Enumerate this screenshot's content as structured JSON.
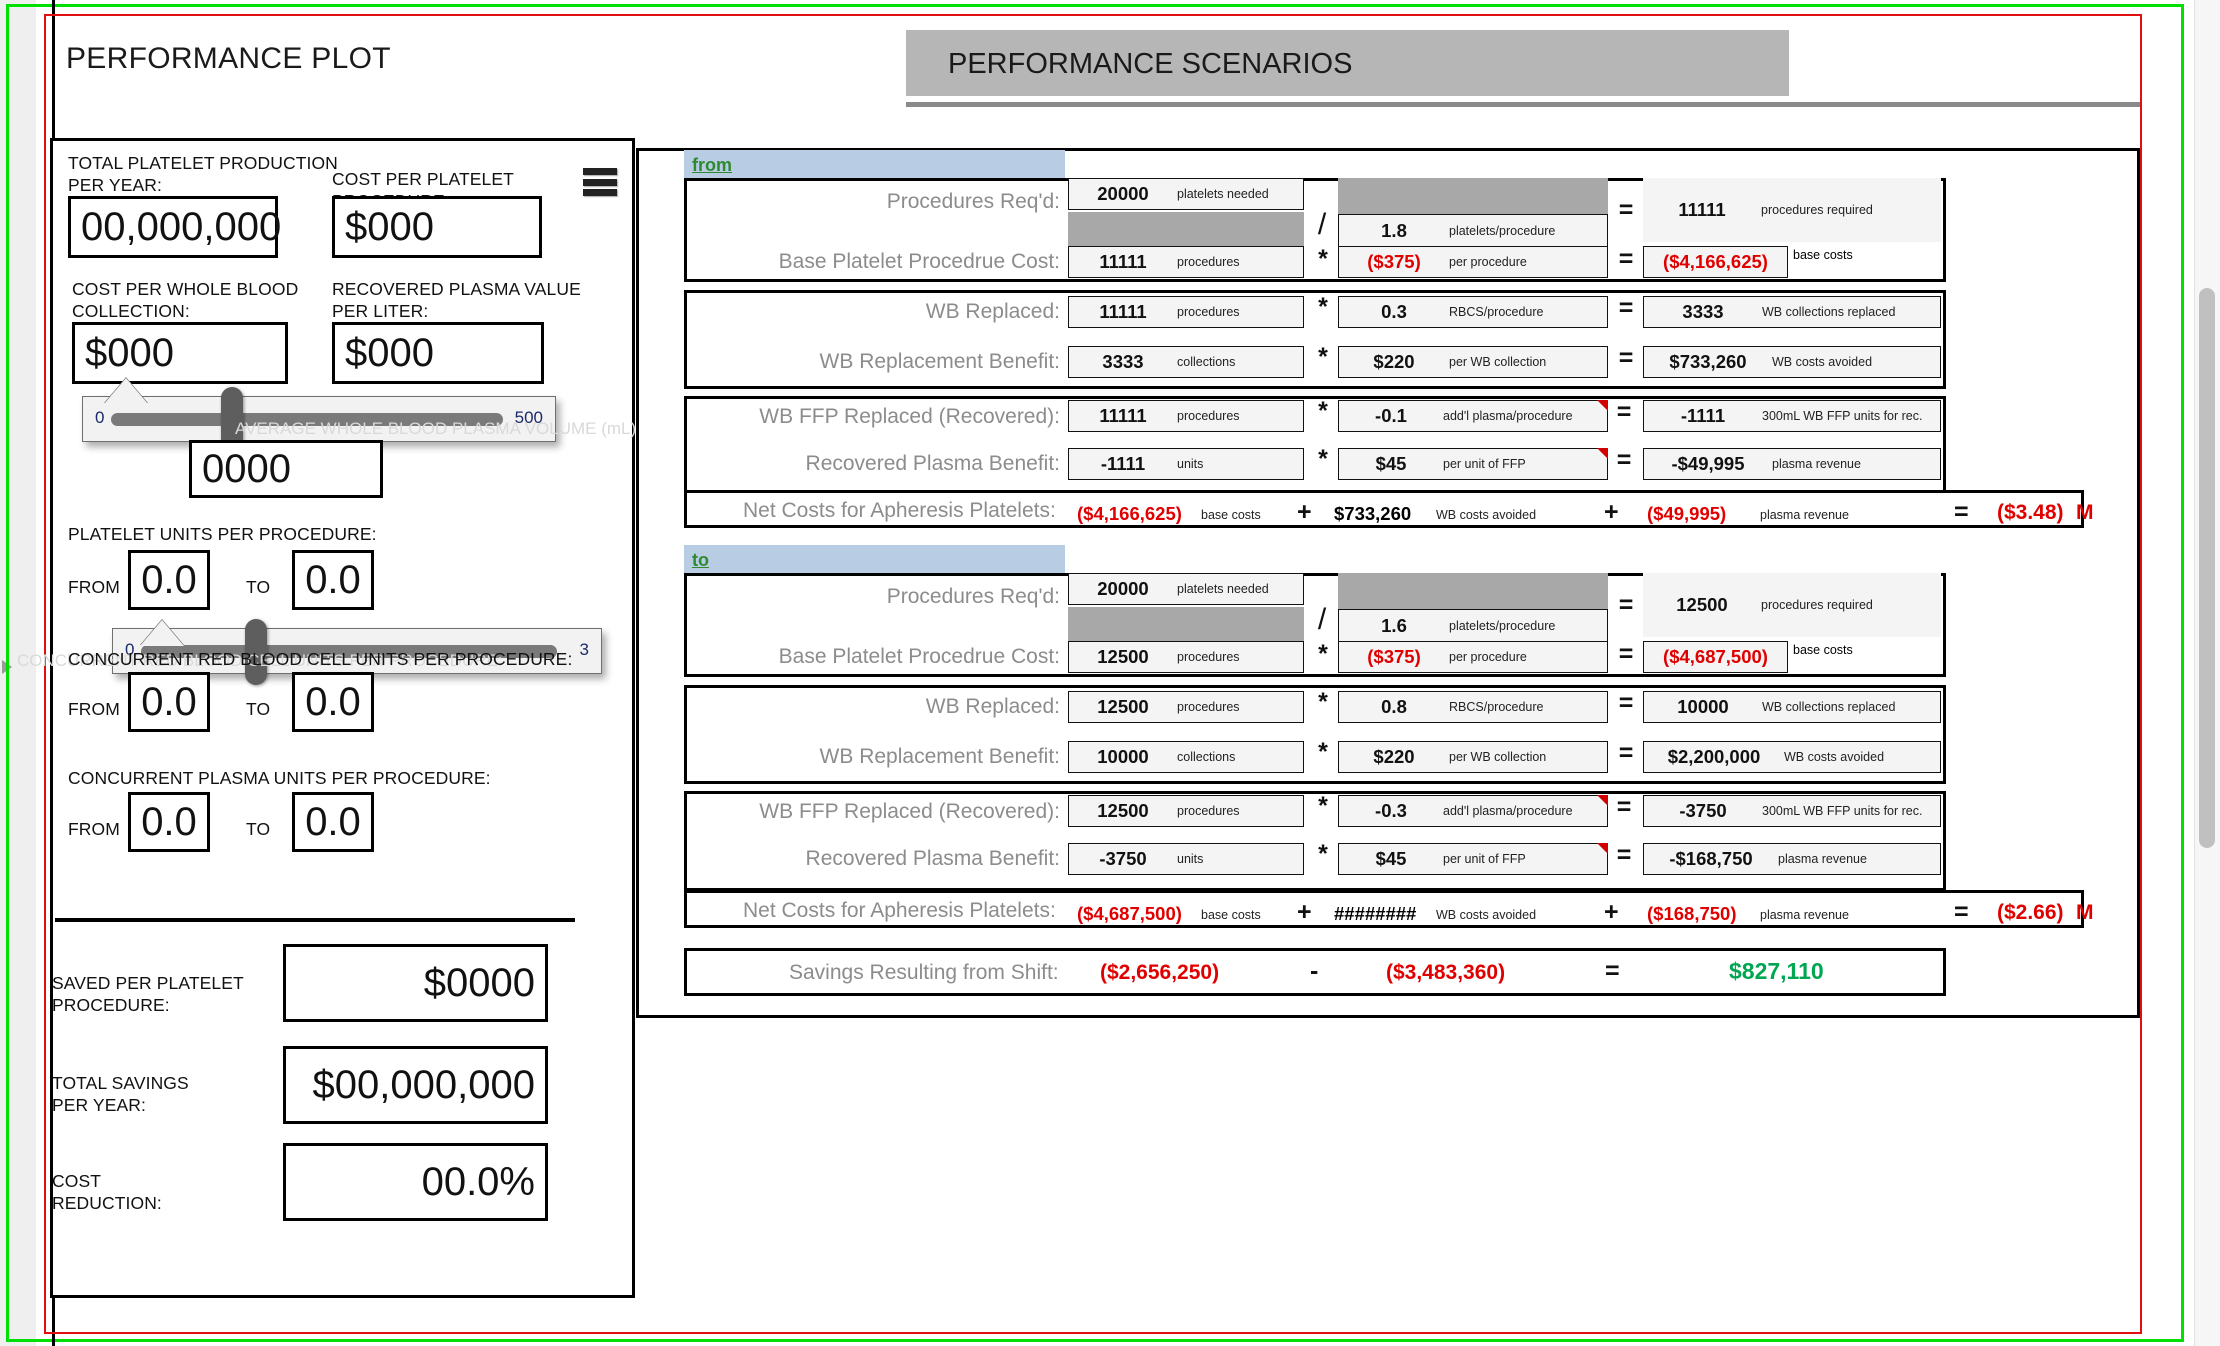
{
  "window": {
    "left_header": "PERFORMANCE PLOT",
    "right_header": "PERFORMANCE SCENARIOS",
    "accent_green": "#00e000",
    "accent_red": "#e01010"
  },
  "left_panel": {
    "menu_icon": "hamburger-icon",
    "fields": [
      {
        "label": "TOTAL PLATELET PRODUCTION\nPER YEAR:",
        "value": "00,000,000"
      },
      {
        "label": "COST PER PLATELET PROCEDURE:",
        "value": "$000"
      },
      {
        "label": "COST PER WHOLE BLOOD\nCOLLECTION:",
        "value": "$000"
      },
      {
        "label": "RECOVERED PLASMA VALUE\nPER LITER:",
        "value": "$000"
      }
    ],
    "plasma_volume_value": "0000",
    "sliders": [
      {
        "name": "average-whole-blood-plasma-volume",
        "ghost_label": "AVERAGE WHOLE BLOOD PLASMA VOLUME (mL):",
        "min": "0",
        "max": "500"
      },
      {
        "name": "concurrent-red-blood-cell-units",
        "ghost_label": "CONCURRENT RED BLOOD CELL UNITS PER PROCEDURE:",
        "min": "0",
        "max": "3"
      }
    ],
    "ranges": [
      {
        "title": "PLATELET UNITS PER PROCEDURE:",
        "from_label": "FROM",
        "from_value": "0.0",
        "to_label": "TO",
        "to_value": "0.0"
      },
      {
        "title": "CONCURRENT RED BLOOD CELL UNITS PER PROCEDURE:",
        "from_label": "FROM",
        "from_value": "0.0",
        "to_label": "TO",
        "to_value": "0.0"
      },
      {
        "title": "CONCURRENT PLASMA UNITS PER PROCEDURE:",
        "from_label": "FROM",
        "from_value": "0.0",
        "to_label": "TO",
        "to_value": "0.0"
      }
    ],
    "results": [
      {
        "label": "SAVED PER PLATELET\nPROCEDURE:",
        "value": "$0000"
      },
      {
        "label": "TOTAL SAVINGS\nPER YEAR:",
        "value": "$00,000,000"
      },
      {
        "label": "COST\nREDUCTION:",
        "value": "00.0%"
      }
    ]
  },
  "scenarios": {
    "from": {
      "tag": "from",
      "procedures_req": {
        "label": "Procedures Req'd:",
        "a_value": "20000",
        "a_unit": "platelets needed",
        "op": "/",
        "b_value": "1.8",
        "b_unit": "platelets/procedure",
        "eq": "=",
        "r_value": "11111",
        "r_unit": "procedures required"
      },
      "base_cost": {
        "label": "Base Platelet Procedrue Cost:",
        "a_value": "11111",
        "a_unit": "procedures",
        "op": "*",
        "b_value": "($375)",
        "b_unit": "per procedure",
        "eq": "=",
        "r_value": "($4,166,625)",
        "r_unit": "base costs"
      },
      "wb_replaced": {
        "label": "WB Replaced:",
        "a_value": "11111",
        "a_unit": "procedures",
        "op": "*",
        "b_value": "0.3",
        "b_unit": "RBCS/procedure",
        "eq": "=",
        "r_value": "3333",
        "r_unit": "WB collections replaced"
      },
      "wb_benefit": {
        "label": "WB Replacement Benefit:",
        "a_value": "3333",
        "a_unit": "collections",
        "op": "*",
        "b_value": "$220",
        "b_unit": "per WB collection",
        "eq": "=",
        "r_value": "$733,260",
        "r_unit": "WB costs avoided"
      },
      "wb_ffp": {
        "label": "WB FFP Replaced (Recovered):",
        "a_value": "11111",
        "a_unit": "procedures",
        "op": "*",
        "b_value": "-0.1",
        "b_unit": "add'l plasma/procedure",
        "eq": "=",
        "r_value": "-1111",
        "r_unit": "300mL WB FFP units for rec."
      },
      "plasma_benefit": {
        "label": "Recovered Plasma Benefit:",
        "a_value": "-1111",
        "a_unit": "units",
        "op": "*",
        "b_value": "$45",
        "b_unit": "per unit of FFP",
        "eq": "=",
        "r_value": "-$49,995",
        "r_unit": "plasma revenue"
      },
      "net": {
        "label": "Net Costs for Apheresis Platelets:",
        "a_value": "($4,166,625)",
        "a_unit": "base costs",
        "op1": "+",
        "b_value": "$733,260",
        "b_unit": "WB costs avoided",
        "op2": "+",
        "c_value": "($49,995)",
        "c_unit": "plasma revenue",
        "eq": "=",
        "total": "($3.48)",
        "total_unit": "M"
      }
    },
    "to": {
      "tag": "to",
      "procedures_req": {
        "label": "Procedures Req'd:",
        "a_value": "20000",
        "a_unit": "platelets needed",
        "op": "/",
        "b_value": "1.6",
        "b_unit": "platelets/procedure",
        "eq": "=",
        "r_value": "12500",
        "r_unit": "procedures required"
      },
      "base_cost": {
        "label": "Base Platelet Procedrue Cost:",
        "a_value": "12500",
        "a_unit": "procedures",
        "op": "*",
        "b_value": "($375)",
        "b_unit": "per procedure",
        "eq": "=",
        "r_value": "($4,687,500)",
        "r_unit": "base costs"
      },
      "wb_replaced": {
        "label": "WB Replaced:",
        "a_value": "12500",
        "a_unit": "procedures",
        "op": "*",
        "b_value": "0.8",
        "b_unit": "RBCS/procedure",
        "eq": "=",
        "r_value": "10000",
        "r_unit": "WB collections replaced"
      },
      "wb_benefit": {
        "label": "WB Replacement Benefit:",
        "a_value": "10000",
        "a_unit": "collections",
        "op": "*",
        "b_value": "$220",
        "b_unit": "per WB collection",
        "eq": "=",
        "r_value": "$2,200,000",
        "r_unit": "WB costs avoided"
      },
      "wb_ffp": {
        "label": "WB FFP Replaced (Recovered):",
        "a_value": "12500",
        "a_unit": "procedures",
        "op": "*",
        "b_value": "-0.3",
        "b_unit": "add'l plasma/procedure",
        "eq": "=",
        "r_value": "-3750",
        "r_unit": "300mL WB FFP units for rec."
      },
      "plasma_benefit": {
        "label": "Recovered Plasma Benefit:",
        "a_value": "-3750",
        "a_unit": "units",
        "op": "*",
        "b_value": "$45",
        "b_unit": "per unit of FFP",
        "eq": "=",
        "r_value": "-$168,750",
        "r_unit": "plasma revenue"
      },
      "net": {
        "label": "Net Costs for Apheresis Platelets:",
        "a_value": "($4,687,500)",
        "a_unit": "base costs",
        "op1": "+",
        "b_value": "########",
        "b_unit": "WB costs avoided",
        "op2": "+",
        "c_value": "($168,750)",
        "c_unit": "plasma revenue",
        "eq": "=",
        "total": "($2.66)",
        "total_unit": "M"
      }
    },
    "savings": {
      "label": "Savings Resulting from Shift:",
      "a_value": "($2,656,250)",
      "op": "-",
      "b_value": "($3,483,360)",
      "eq": "=",
      "result": "$827,110"
    }
  }
}
